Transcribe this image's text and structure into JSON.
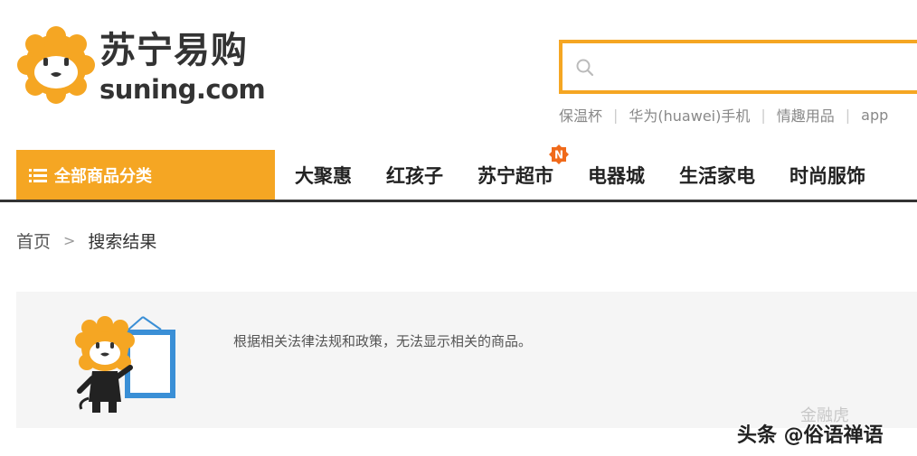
{
  "logo": {
    "cn": "苏宁易购",
    "en": "suning.com"
  },
  "search": {
    "placeholder": ""
  },
  "hot_words": [
    "保温杯",
    "华为(huawei)手机",
    "情趣用品",
    "app"
  ],
  "nav": {
    "category_label": "全部商品分类",
    "items": [
      "大聚惠",
      "红孩子",
      "苏宁超市",
      "电器城",
      "生活家电",
      "时尚服饰"
    ],
    "badge": "N"
  },
  "breadcrumb": {
    "home": "首页",
    "separator": ">",
    "current": "搜索结果"
  },
  "notice": {
    "message": "根据相关法律法规和政策，无法显示相关的商品。"
  },
  "watermark": {
    "faint": "金融虎",
    "main": "头条 @俗语禅语"
  },
  "colors": {
    "brand_orange": "#f5a623",
    "nav_line": "#333333",
    "panel_bg": "#f5f5f5"
  }
}
